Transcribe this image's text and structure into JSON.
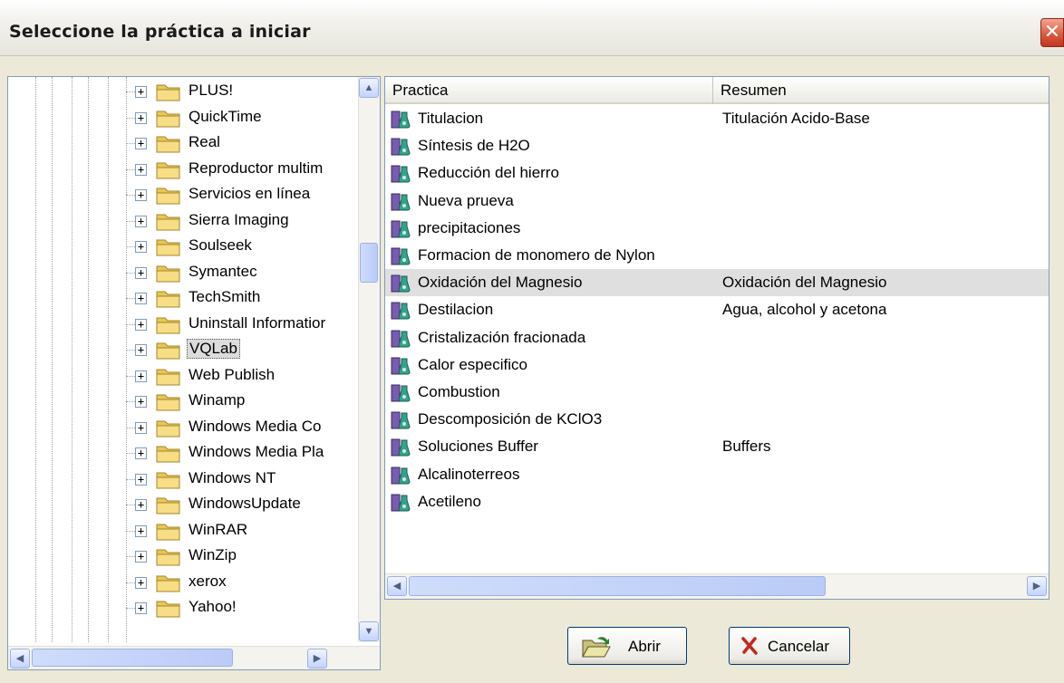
{
  "window": {
    "title": "Seleccione la práctica a iniciar",
    "close_glyph": "✕"
  },
  "tree": {
    "items": [
      {
        "label": "PLUS!"
      },
      {
        "label": "QuickTime"
      },
      {
        "label": "Real"
      },
      {
        "label": "Reproductor multim"
      },
      {
        "label": "Servicios en línea"
      },
      {
        "label": "Sierra Imaging"
      },
      {
        "label": "Soulseek"
      },
      {
        "label": "Symantec"
      },
      {
        "label": "TechSmith"
      },
      {
        "label": "Uninstall Informatior"
      },
      {
        "label": "VQLab",
        "selected": true
      },
      {
        "label": "Web Publish"
      },
      {
        "label": "Winamp"
      },
      {
        "label": "Windows Media Co"
      },
      {
        "label": "Windows Media Pla"
      },
      {
        "label": "Windows NT"
      },
      {
        "label": "WindowsUpdate"
      },
      {
        "label": "WinRAR"
      },
      {
        "label": "WinZip"
      },
      {
        "label": "xerox"
      },
      {
        "label": "Yahoo!"
      }
    ],
    "expander_glyph": "+",
    "folder_color": "#f2d56b"
  },
  "list": {
    "columns": [
      "Practica",
      "Resumen"
    ],
    "rows": [
      {
        "name": "Titulacion",
        "summary": "Titulación Acido-Base"
      },
      {
        "name": "Síntesis de H2O",
        "summary": ""
      },
      {
        "name": "Reducción del hierro",
        "summary": ""
      },
      {
        "name": "Nueva prueva",
        "summary": ""
      },
      {
        "name": "precipitaciones",
        "summary": ""
      },
      {
        "name": "Formacion de monomero de Nylon",
        "summary": ""
      },
      {
        "name": "Oxidación del Magnesio",
        "summary": "Oxidación del Magnesio",
        "selected": true
      },
      {
        "name": "Destilacion",
        "summary": "Agua, alcohol y acetona"
      },
      {
        "name": "Cristalización fracionada",
        "summary": ""
      },
      {
        "name": "Calor especifico",
        "summary": ""
      },
      {
        "name": "Combustion",
        "summary": ""
      },
      {
        "name": "Descomposición de KClO3",
        "summary": ""
      },
      {
        "name": "Soluciones Buffer",
        "summary": "Buffers"
      },
      {
        "name": "Alcalinoterreos",
        "summary": ""
      },
      {
        "name": "Acetileno",
        "summary": ""
      }
    ]
  },
  "buttons": {
    "open_label": "Abrir",
    "cancel_label": "Cancelar"
  },
  "colors": {
    "accent_border": "#7f9db9",
    "dialog_bg": "#ece9d8",
    "cancel_x": "#c0281b"
  }
}
